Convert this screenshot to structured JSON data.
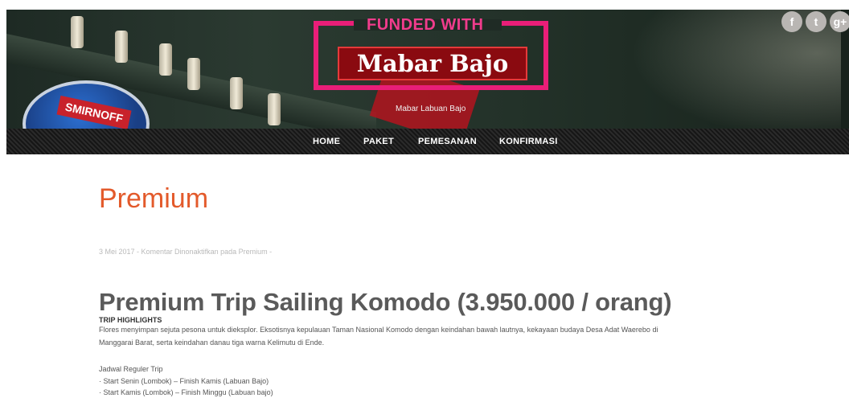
{
  "header": {
    "logo_top": "FUNDED WITH",
    "logo_name": "Mabar Bajo",
    "tagline": "Mabar Labuan Bajo",
    "smirnoff_text": "SMIRNOFF",
    "social": [
      "f",
      "t",
      "g+"
    ]
  },
  "nav": {
    "items": [
      "HOME",
      "PAKET",
      "PEMESANAN",
      "KONFIRMASI"
    ]
  },
  "page": {
    "title": "Premium",
    "meta": "3 Mei 2017 - Komentar Dinonaktifkan pada Premium -",
    "heading": "Premium Trip Sailing Komodo (3.950.000 / orang)",
    "highlight_title": "TRIP HIGHLIGHTS",
    "para_1": "Flores menyimpan sejuta pesona untuk dieksplor. Eksotisnya kepulauan Taman Nasional Komodo dengan keindahan bawah lautnya, kekayaan budaya Desa Adat Waerebo di",
    "para_2": "Manggarai Barat, serta keindahan danau tiga warna Kelimutu di Ende.",
    "schedule_title": "Jadwal Reguler Trip",
    "schedule_1": "· Start Senin (Lombok) – Finish Kamis (Labuan Bajo)",
    "schedule_2": "· Start Kamis (Lombok) – Finish Minggu (Labuan bajo)"
  },
  "colors": {
    "accent": "#e35a2b",
    "logo_pink": "#e91e78",
    "logo_red": "#8a0a10"
  }
}
